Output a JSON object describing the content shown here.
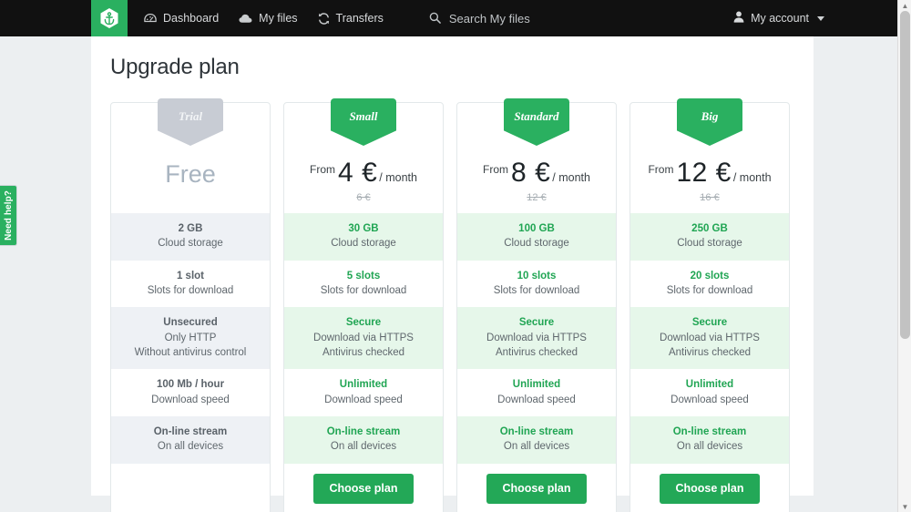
{
  "navbar": {
    "brand_icon": "anchor-hexagon-logo",
    "links": [
      {
        "label": "Dashboard",
        "icon": "dashboard-icon"
      },
      {
        "label": "My files",
        "icon": "cloud-icon"
      },
      {
        "label": "Transfers",
        "icon": "sync-icon"
      }
    ],
    "search": {
      "icon": "search-icon",
      "placeholder": "Search My files",
      "value": ""
    },
    "account": {
      "label": "My account",
      "icon": "user-icon",
      "caret": "chevron-down-icon"
    }
  },
  "side_tab": {
    "label": "Need help?"
  },
  "page": {
    "title": "Upgrade plan"
  },
  "colors": {
    "brand_green": "#2ab060",
    "button_green": "#23a857",
    "value_green": "#20a553",
    "row_green_bg": "#e6f7ea",
    "row_gray_bg": "#eef1f5",
    "badge_gray": "#c8ccd4",
    "navbar_bg": "#111111",
    "page_bg": "#eceff1"
  },
  "feature_labels": {
    "storage": "Cloud storage",
    "slots": "Slots for download",
    "speed": "Download speed",
    "stream": "On all devices"
  },
  "plans": [
    {
      "id": "trial",
      "badge": "Trial",
      "badge_style": "gray",
      "price_type": "free",
      "free_label": "Free",
      "from_label": "",
      "amount": "",
      "period": "",
      "old_price": "",
      "features": [
        {
          "value": "2 GB",
          "sub": "Cloud storage"
        },
        {
          "value": "1 slot",
          "sub": "Slots for download"
        },
        {
          "value": "Unsecured",
          "sub": "Only HTTP",
          "sub2": "Without antivirus control"
        },
        {
          "value": "100 Mb / hour",
          "sub": "Download speed"
        },
        {
          "value": "On-line stream",
          "sub": "On all devices"
        }
      ],
      "cta": ""
    },
    {
      "id": "small",
      "badge": "Small",
      "badge_style": "green",
      "price_type": "paid",
      "free_label": "",
      "from_label": "From",
      "amount": "4 €",
      "period": "/ month",
      "old_price": "6 €",
      "features": [
        {
          "value": "30 GB",
          "sub": "Cloud storage"
        },
        {
          "value": "5 slots",
          "sub": "Slots for download"
        },
        {
          "value": "Secure",
          "sub": "Download via HTTPS",
          "sub2": "Antivirus checked"
        },
        {
          "value": "Unlimited",
          "sub": "Download speed"
        },
        {
          "value": "On-line stream",
          "sub": "On all devices"
        }
      ],
      "cta": "Choose plan"
    },
    {
      "id": "standard",
      "badge": "Standard",
      "badge_style": "green",
      "price_type": "paid",
      "free_label": "",
      "from_label": "From",
      "amount": "8 €",
      "period": "/ month",
      "old_price": "12 €",
      "features": [
        {
          "value": "100 GB",
          "sub": "Cloud storage"
        },
        {
          "value": "10 slots",
          "sub": "Slots for download"
        },
        {
          "value": "Secure",
          "sub": "Download via HTTPS",
          "sub2": "Antivirus checked"
        },
        {
          "value": "Unlimited",
          "sub": "Download speed"
        },
        {
          "value": "On-line stream",
          "sub": "On all devices"
        }
      ],
      "cta": "Choose plan"
    },
    {
      "id": "big",
      "badge": "Big",
      "badge_style": "green",
      "price_type": "paid",
      "free_label": "",
      "from_label": "From",
      "amount": "12 €",
      "period": "/ month",
      "old_price": "16 €",
      "features": [
        {
          "value": "250 GB",
          "sub": "Cloud storage"
        },
        {
          "value": "20 slots",
          "sub": "Slots for download"
        },
        {
          "value": "Secure",
          "sub": "Download via HTTPS",
          "sub2": "Antivirus checked"
        },
        {
          "value": "Unlimited",
          "sub": "Download speed"
        },
        {
          "value": "On-line stream",
          "sub": "On all devices"
        }
      ],
      "cta": "Choose plan"
    }
  ]
}
